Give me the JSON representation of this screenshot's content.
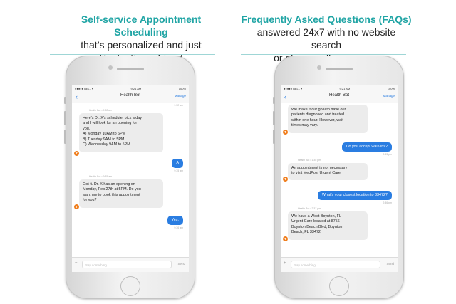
{
  "left": {
    "headline_title": "Self-service Appointment Scheduling",
    "headline_line2": "that’s personalized and just",
    "headline_line3": "like texting a friend",
    "status": {
      "carrier": "●●●●● BELL ▾",
      "time": "9:21 AM",
      "battery": "100%"
    },
    "nav": {
      "back": "‹",
      "title": "Health Bot",
      "manage": "Manage"
    },
    "top_time": "9:32 am",
    "messages": [
      {
        "meta": "Health Bot • 9:32 am",
        "lines": [
          "Here's Dr. X's schedule, pick a day",
          "and I will look for an opening for",
          "you.",
          "A) Monday 10AM to 6PM",
          "B) Tuesday 9AM to 5PM",
          "C) Wednesday 9AM to 5PM"
        ]
      },
      {
        "user": "A",
        "time": "9:35 am"
      },
      {
        "meta": "Health Bot • 9:35 am",
        "lines": [
          "Got it. Dr. X has an opening on",
          "Monday, Feb 27th at 5PM. Do you",
          "want me to book this appointment",
          "for you?"
        ]
      },
      {
        "user": "Yes.",
        "time": "9:36 am"
      }
    ],
    "composer": {
      "plus": "+",
      "placeholder": "Say something...",
      "send": "Send"
    }
  },
  "right": {
    "headline_title": "Frequently Asked Questions (FAQs)",
    "headline_line2": "answered 24x7 with no website search",
    "headline_line3": "or phone call necessary",
    "status": {
      "carrier": "●●●●● BELL ▾",
      "time": "9:21 AM",
      "battery": "100%"
    },
    "nav": {
      "back": "‹",
      "title": "Health Bot",
      "manage": "Manage"
    },
    "messages": [
      {
        "lines": [
          "We make it our goal to have our",
          "patients diagnosed and treated",
          "within one hour. However, wait",
          "times may vary."
        ]
      },
      {
        "user": "Do you accept walk-ins?",
        "time": "2:33 pm"
      },
      {
        "meta": "Health Bot • 1:35 pm",
        "lines": [
          "An appointment is not necessary",
          "to visit MedPost Urgent Care."
        ]
      },
      {
        "user": "What's your closest location to 33472?",
        "time": "2:36 pm"
      },
      {
        "meta": "Health Bot • 2:37 pm",
        "lines": [
          "We have a West Boynton, FL",
          "Urgent Care located at 8756",
          "Boynton Beach Blvd, Boynton",
          "Beach, FL 33472."
        ]
      }
    ],
    "composer": {
      "plus": "+",
      "placeholder": "Say something...",
      "send": "Send"
    }
  },
  "bot_avatar_letter": "T",
  "colors": {
    "accent_teal": "#21a5a5",
    "user_bubble": "#2a7de1",
    "bot_bubble": "#ececec",
    "avatar": "#f07f1f"
  }
}
